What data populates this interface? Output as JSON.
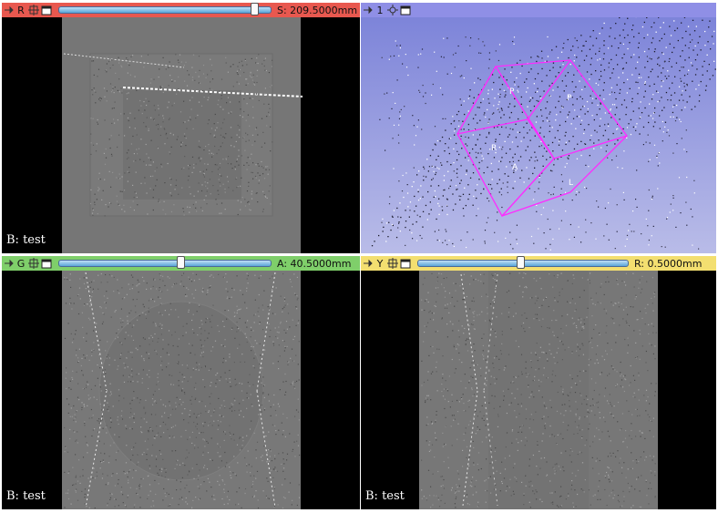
{
  "views": {
    "red": {
      "letter": "R",
      "value": "S: 209.5000mm",
      "slider_fraction": 0.94,
      "corner": "B: test",
      "color": "#e8584f"
    },
    "three_d": {
      "number": "1",
      "color": "#8f8fe6",
      "cube_labels": [
        "P",
        "P",
        "R",
        "A",
        "L"
      ]
    },
    "green": {
      "letter": "G",
      "value": "A: 40.5000mm",
      "slider_fraction": 0.58,
      "corner": "B: test",
      "color": "#7fcf6a"
    },
    "yellow": {
      "letter": "Y",
      "value": "R: 0.5000mm",
      "slider_fraction": 0.49,
      "corner": "B: test",
      "color": "#f3df70"
    }
  },
  "icons": {
    "pin": "pin-icon",
    "link": "link-icon",
    "maximize": "maximize-icon",
    "center": "center-view-icon"
  }
}
